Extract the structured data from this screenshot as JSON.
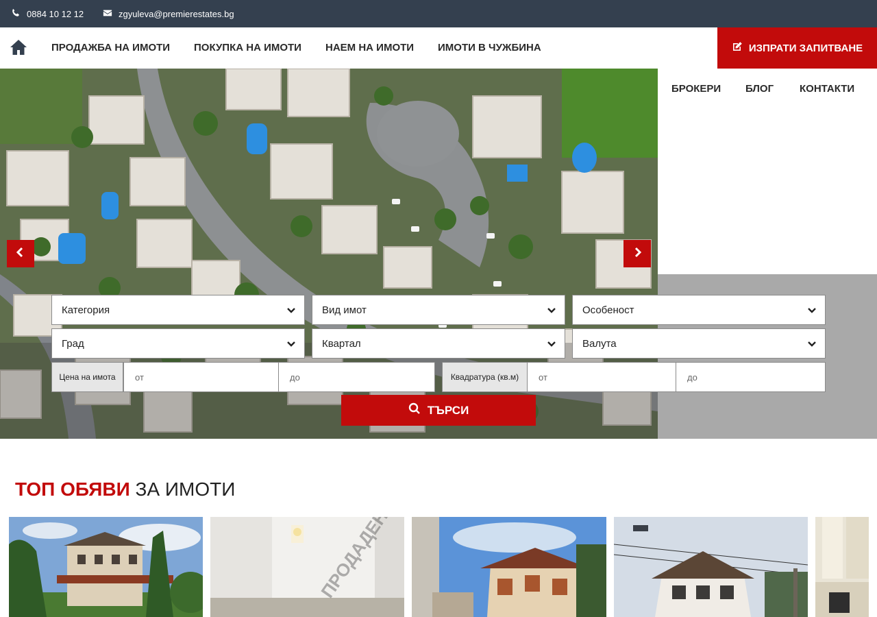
{
  "topbar": {
    "phone": "0884 10 12 12",
    "email": "zgyuleva@premierestates.bg",
    "phone_icon": "phone-icon",
    "email_icon": "envelope-icon"
  },
  "nav": {
    "home_icon": "home-icon",
    "links": [
      "ПРОДАЖБА НА ИМОТИ",
      "ПОКУПКА НА ИМОТИ",
      "НАЕМ НА ИМОТИ",
      "ИМОТИ В ЧУЖБИНА"
    ],
    "secondary_links": [
      "БРОКЕРИ",
      "БЛОГ",
      "КОНТАКТИ"
    ],
    "cta_label": "ИЗПРАТИ ЗАПИТВАНЕ",
    "cta_icon": "edit-icon"
  },
  "search": {
    "selects": {
      "category": "Категория",
      "property_type": "Вид имот",
      "feature": "Особеност",
      "city": "Град",
      "district": "Квартал",
      "currency": "Валута"
    },
    "price": {
      "label": "Цена на имота",
      "from": "от",
      "to": "до"
    },
    "area": {
      "label": "Квадратура (кв.м)",
      "from": "от",
      "to": "до"
    },
    "button_label": "ТЪРСИ"
  },
  "listings": {
    "title_highlight": "ТОП ОБЯВИ",
    "title_rest": " ЗА ИМОТИ",
    "sold_watermark": "ПРОДАДЕН"
  },
  "colors": {
    "accent": "#c20b0b",
    "topbar": "#34404f"
  }
}
